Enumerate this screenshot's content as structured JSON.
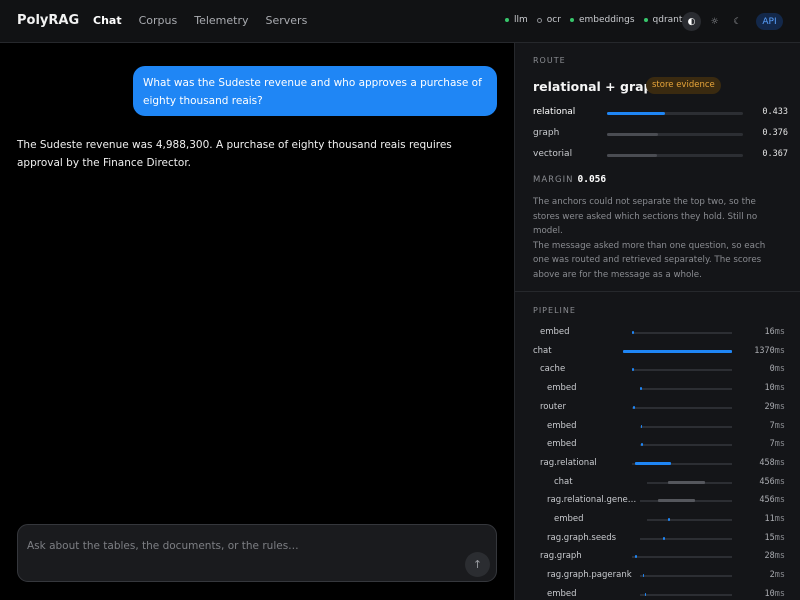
{
  "header": {
    "brand": "PolyRAG",
    "nav": [
      {
        "label": "Chat",
        "active": true
      },
      {
        "label": "Corpus",
        "active": false
      },
      {
        "label": "Telemetry",
        "active": false
      },
      {
        "label": "Servers",
        "active": false
      }
    ],
    "status": [
      {
        "label": "llm",
        "state": "up"
      },
      {
        "label": "ocr",
        "state": "down"
      },
      {
        "label": "embeddings",
        "state": "up"
      },
      {
        "label": "qdrant",
        "state": "up"
      }
    ],
    "theme_icons": [
      "contrast-icon",
      "sun-icon",
      "moon-icon"
    ],
    "api_label": "API"
  },
  "chat": {
    "user_message": "What was the Sudeste revenue and who approves a purchase of eighty thousand reais?",
    "assistant_message": "The Sudeste revenue was 4,988,300. A purchase of eighty thousand reais requires approval by the Finance Director.",
    "composer_placeholder": "Ask about the tables, the documents, or the rules…",
    "send_icon": "arrow-up-icon"
  },
  "route": {
    "section_label": "ROUTE",
    "title": "relational + graph",
    "badge": "store evidence",
    "scores": [
      {
        "name": "relational",
        "value": "0.433",
        "fraction": 0.433
      },
      {
        "name": "graph",
        "value": "0.376",
        "fraction": 0.376
      },
      {
        "name": "vectorial",
        "value": "0.367",
        "fraction": 0.367
      }
    ],
    "margin_label": "MARGIN",
    "margin_value": "0.056",
    "notes": [
      "The anchors could not separate the top two, so the stores were asked which sections they hold. Still no model.",
      "The message asked more than one question, so each one was routed and retrieved separately. The scores above are for the message as a whole."
    ]
  },
  "pipeline": {
    "section_label": "PIPELINE",
    "unit": "ms",
    "total_ms": 1370,
    "spans": [
      {
        "name": "embed",
        "ms": 16,
        "depth": 1,
        "start": 0.0
      },
      {
        "name": "chat",
        "ms": 1370,
        "depth": 0,
        "start": 0.0
      },
      {
        "name": "cache",
        "ms": 0,
        "depth": 1,
        "start": 0.0
      },
      {
        "name": "embed",
        "ms": 10,
        "depth": 2,
        "start": 0.0
      },
      {
        "name": "router",
        "ms": 29,
        "depth": 1,
        "start": 0.008
      },
      {
        "name": "embed",
        "ms": 7,
        "depth": 2,
        "start": 0.008
      },
      {
        "name": "embed",
        "ms": 7,
        "depth": 2,
        "start": 0.013
      },
      {
        "name": "rag.relational",
        "ms": 458,
        "depth": 1,
        "start": 0.03
      },
      {
        "name": "chat",
        "ms": 456,
        "depth": 3,
        "start": 0.25
      },
      {
        "name": "rag.relational.gene…",
        "ms": 456,
        "depth": 2,
        "start": 0.2
      },
      {
        "name": "embed",
        "ms": 11,
        "depth": 3,
        "start": 0.25
      },
      {
        "name": "rag.graph.seeds",
        "ms": 15,
        "depth": 2,
        "start": 0.25
      },
      {
        "name": "rag.graph",
        "ms": 28,
        "depth": 1,
        "start": 0.03
      },
      {
        "name": "rag.graph.pagerank",
        "ms": 2,
        "depth": 2,
        "start": 0.03
      },
      {
        "name": "embed",
        "ms": 10,
        "depth": 2,
        "start": 0.05
      }
    ]
  },
  "colors": {
    "accent": "#1f86f5",
    "status_up": "#37c66b",
    "badge_text": "#e8a53a"
  }
}
